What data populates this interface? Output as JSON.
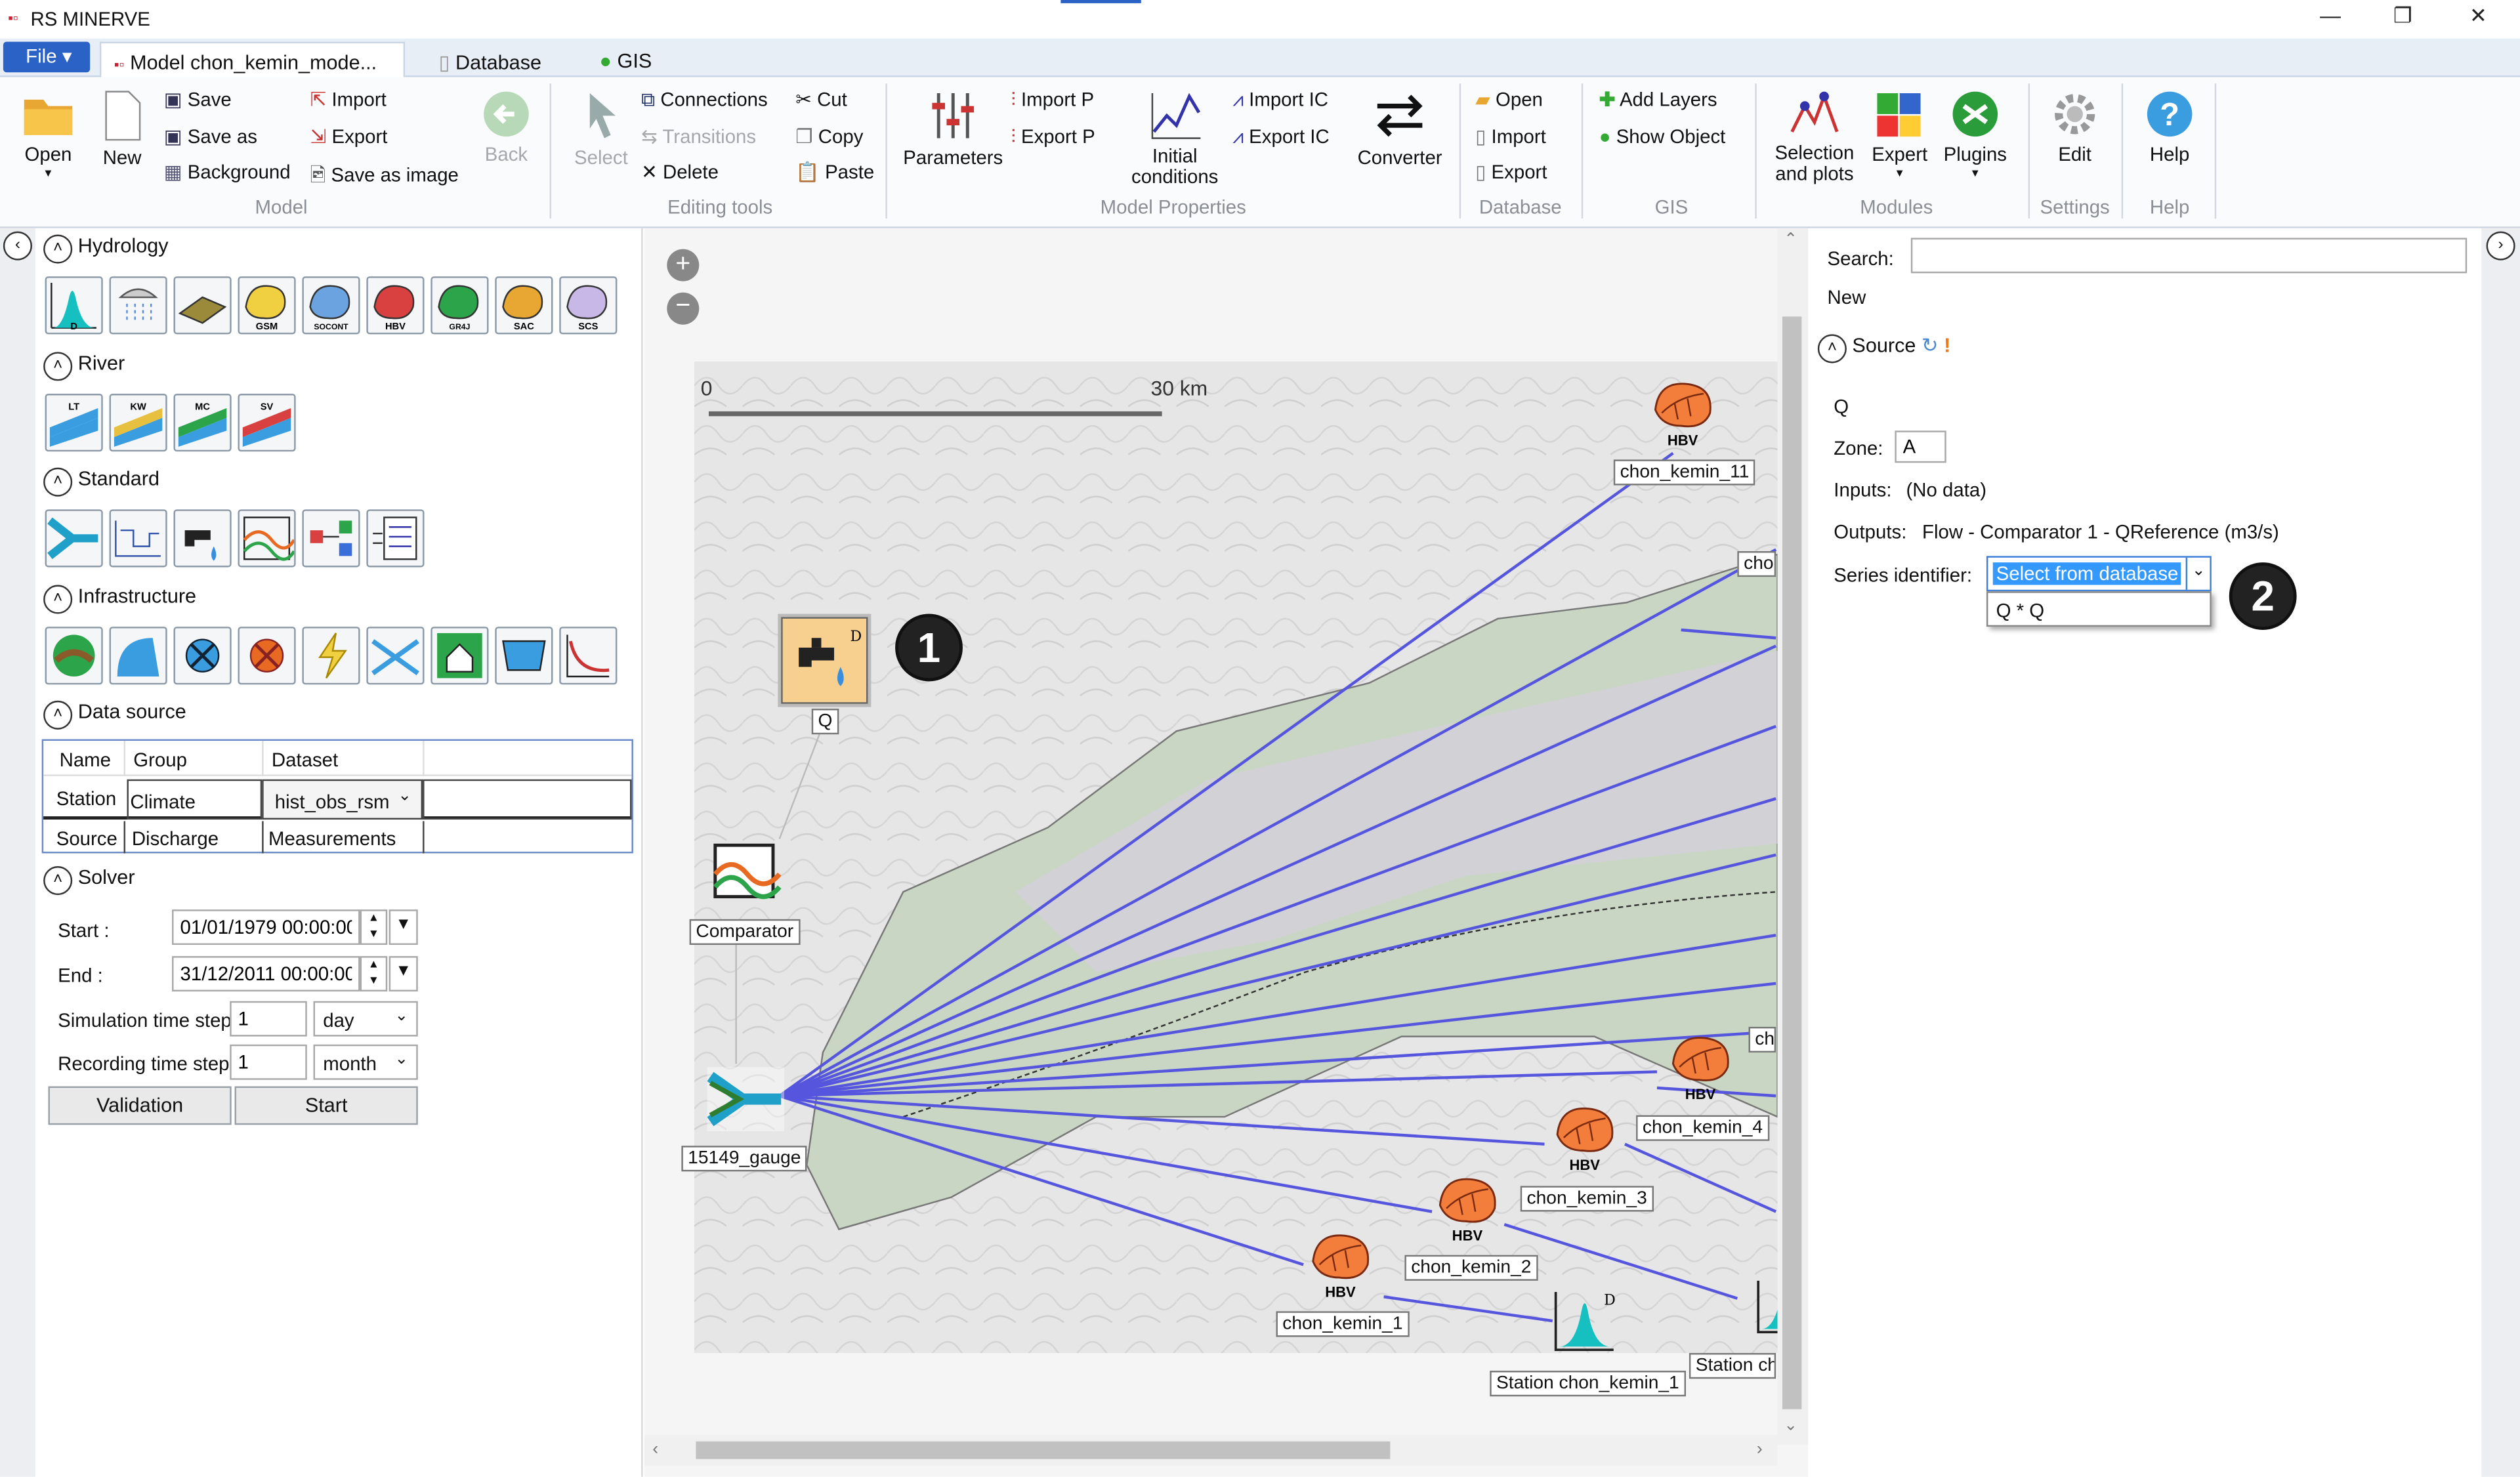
{
  "app": {
    "title": "RS MINERVE"
  },
  "window_controls": {
    "minimize": "—",
    "maximize": "❐",
    "close": "✕"
  },
  "tabs": {
    "file": "File",
    "model": "Model chon_kemin_mode...",
    "database": "Database",
    "gis": "GIS"
  },
  "ribbon": {
    "model": {
      "open": "Open",
      "new": "New",
      "save": "Save",
      "save_as": "Save as",
      "background": "Background",
      "import": "Import",
      "export": "Export",
      "save_image": "Save as image",
      "back": "Back",
      "group": "Model"
    },
    "editing": {
      "select": "Select",
      "connections": "Connections",
      "transitions": "Transitions",
      "delete": "Delete",
      "cut": "Cut",
      "copy": "Copy",
      "paste": "Paste",
      "group": "Editing tools"
    },
    "properties": {
      "parameters": "Parameters",
      "import_p": "Import P",
      "export_p": "Export P",
      "initial": "Initial",
      "conditions": "conditions",
      "import_ic": "Import IC",
      "export_ic": "Export IC",
      "converter": "Converter",
      "group": "Model Properties"
    },
    "database": {
      "open": "Open",
      "import": "Import",
      "export": "Export",
      "group": "Database"
    },
    "gis": {
      "add_layers": "Add Layers",
      "show_object": "Show Object",
      "group": "GIS"
    },
    "modules": {
      "selection": "Selection",
      "and_plots": "and plots",
      "expert": "Expert",
      "plugins": "Plugins",
      "group": "Modules"
    },
    "settings": {
      "edit": "Edit",
      "group": "Settings"
    },
    "help": {
      "help": "Help",
      "group": "Help"
    }
  },
  "left": {
    "hydrology": {
      "title": "Hydrology",
      "tools": [
        "D",
        "",
        "",
        "GSM",
        "SOCONT",
        "HBV",
        "GR4J",
        "SAC",
        "SCS"
      ]
    },
    "river": {
      "title": "River",
      "tools": [
        "LT",
        "KW",
        "MC",
        "SV"
      ]
    },
    "standard": {
      "title": "Standard"
    },
    "infrastructure": {
      "title": "Infrastructure"
    },
    "datasource": {
      "title": "Data source",
      "headers": [
        "Name",
        "Group",
        "Dataset"
      ],
      "rows": [
        [
          "Station",
          "Climate",
          "hist_obs_rsm"
        ],
        [
          "Source",
          "Discharge",
          "Measurements"
        ]
      ]
    },
    "solver": {
      "title": "Solver",
      "start_label": "Start :",
      "start_value": "01/01/1979 00:00:00",
      "end_label": "End :",
      "end_value": "31/12/2011 00:00:00",
      "sim_label": "Simulation time step",
      "sim_value": "1",
      "sim_unit": "day",
      "rec_label": "Recording time step:",
      "rec_value": "1",
      "rec_unit": "month",
      "validation": "Validation",
      "start_btn": "Start"
    }
  },
  "canvas": {
    "scale_start": "0",
    "scale_end": "30 km",
    "marker1": "1",
    "labels": {
      "q": "Q",
      "comparator": "Comparator",
      "gauge": "15149_gauge",
      "ck11": "chon_kemin_11",
      "cho": "chor",
      "ch": "ch",
      "ck4": "chon_kemin_4",
      "ck3": "chon_kemin_3",
      "ck2": "chon_kemin_2",
      "ck1": "chon_kemin_1",
      "station1": "Station chon_kemin_1",
      "station2": "Station ch"
    },
    "hbv": "HBV"
  },
  "right": {
    "search_label": "Search:",
    "new_label": "New",
    "source_title": "Source",
    "q": "Q",
    "zone_label": "Zone:",
    "zone_value": "A",
    "inputs_label": "Inputs:",
    "inputs_value": "(No data)",
    "outputs_label": "Outputs:",
    "outputs_value": "Flow - Comparator 1 - QReference (m3/s)",
    "series_label": "Series identifier:",
    "series_value": "Select from database",
    "series_option": "Q * Q",
    "marker2": "2"
  },
  "colors": {
    "accent": "#2b62c6",
    "selection": "#3399ff",
    "link": "#5555dd"
  }
}
